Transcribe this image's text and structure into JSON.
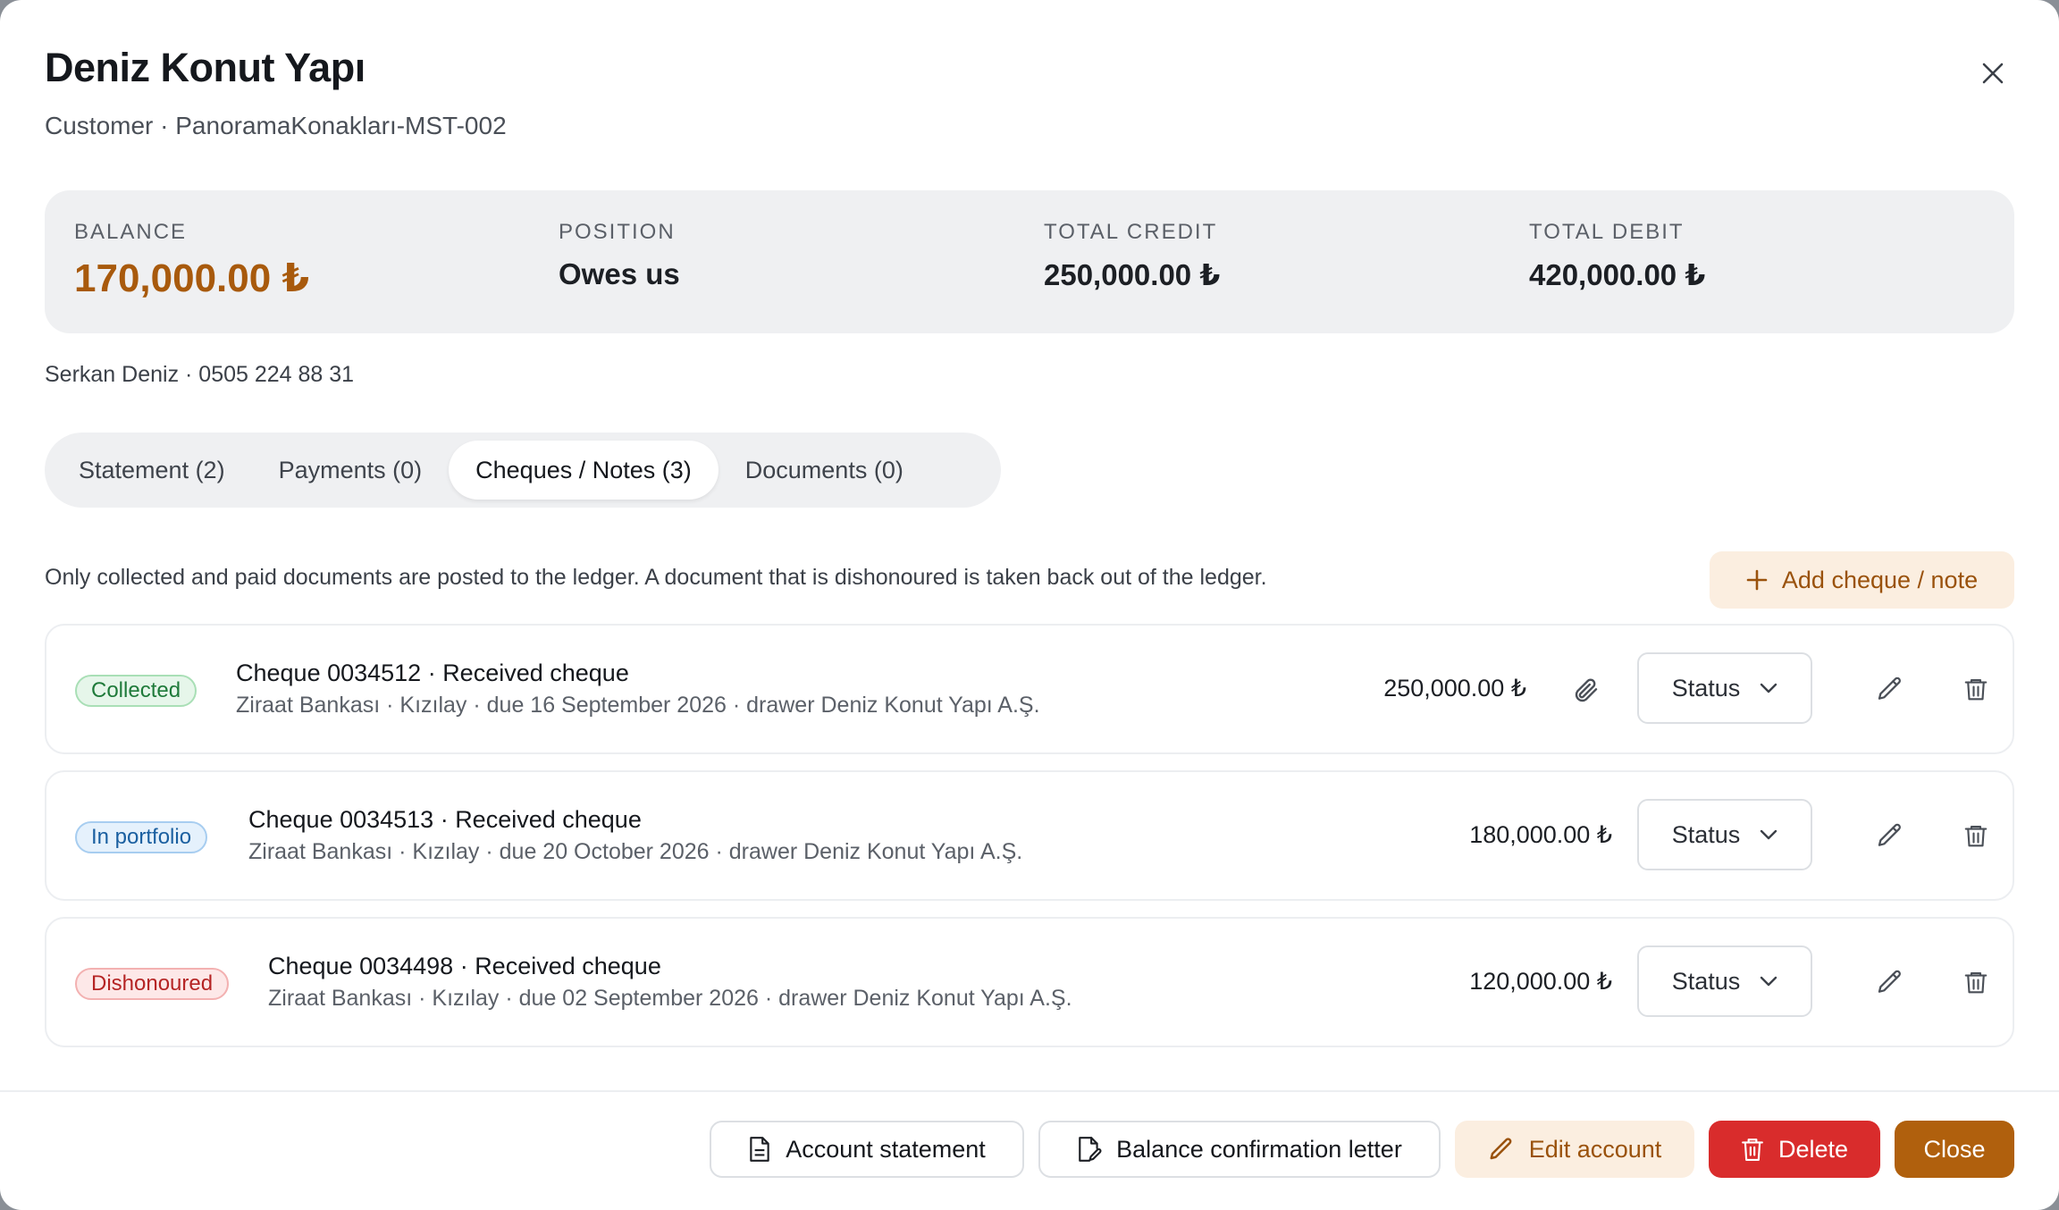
{
  "header": {
    "title": "Deniz Konut Yapı",
    "subtitle": "Customer · PanoramaKonakları-MST-002"
  },
  "summary": {
    "balance_label": "BALANCE",
    "balance_value": "170,000.00 ₺",
    "position_label": "POSITION",
    "position_value": "Owes us",
    "credit_label": "TOTAL CREDIT",
    "credit_value": "250,000.00 ₺",
    "debit_label": "TOTAL DEBIT",
    "debit_value": "420,000.00 ₺"
  },
  "contact": "Serkan Deniz · 0505 224 88 31",
  "tabs": [
    {
      "label": "Statement (2)"
    },
    {
      "label": "Payments (0)"
    },
    {
      "label": "Cheques / Notes (3)"
    },
    {
      "label": "Documents (0)"
    }
  ],
  "notice": "Only collected and paid documents are posted to the ledger. A document that is dishonoured is taken back out of the ledger.",
  "add_button": "Add cheque / note",
  "cheques": [
    {
      "status": "Collected",
      "title": "Cheque 0034512 · Received cheque",
      "details": "Ziraat Bankası · Kızılay · due 16 September 2026 · drawer Deniz Konut Yapı A.Ş.",
      "amount": "250,000.00 ₺",
      "status_button": "Status"
    },
    {
      "status": "In portfolio",
      "title": "Cheque 0034513 · Received cheque",
      "details": "Ziraat Bankası · Kızılay · due 20 October 2026 · drawer Deniz Konut Yapı A.Ş.",
      "amount": "180,000.00 ₺",
      "status_button": "Status"
    },
    {
      "status": "Dishonoured",
      "title": "Cheque 0034498 · Received cheque",
      "details": "Ziraat Bankası · Kızılay · due 02 September 2026 · drawer Deniz Konut Yapı A.Ş.",
      "amount": "120,000.00 ₺",
      "status_button": "Status"
    }
  ],
  "footer": {
    "account_statement": "Account statement",
    "balance_letter": "Balance confirmation letter",
    "edit_account": "Edit account",
    "delete": "Delete",
    "close": "Close"
  },
  "colors": {
    "accent": "#b0600d",
    "balance": "#a85a0d",
    "danger": "#d92c2c"
  }
}
